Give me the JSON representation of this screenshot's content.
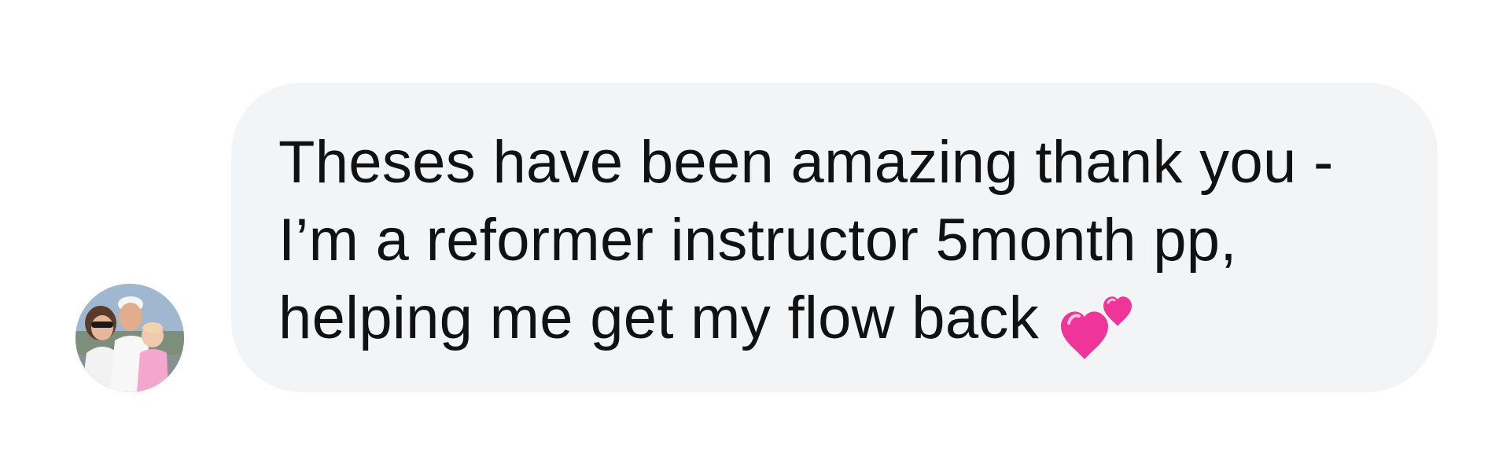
{
  "message": {
    "sender_avatar_icon": "profile-photo-avatar",
    "bubble_color": "#f3f4f6",
    "text_color": "#111111",
    "lines": [
      "Theses have been amazing thank you -",
      "I’m a reformer instructor 5month pp,",
      "helping me get my flow back"
    ],
    "emoji": "💕",
    "emoji_icon": "two-hearts-icon",
    "emoji_color": "#f0359a"
  }
}
